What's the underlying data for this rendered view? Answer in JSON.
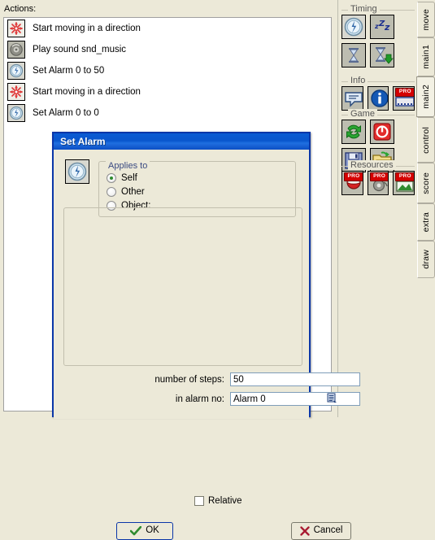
{
  "app": {
    "actions_label": "Actions:"
  },
  "actions_list": {
    "items": [
      {
        "icon": "move-star-icon",
        "label": "Start moving in a direction"
      },
      {
        "icon": "sound-icon",
        "label": "Play sound snd_music"
      },
      {
        "icon": "alarm-clock-icon",
        "label": "Set Alarm 0 to 50"
      },
      {
        "icon": "move-star-icon",
        "label": "Start moving in a direction"
      },
      {
        "icon": "alarm-clock-icon",
        "label": "Set Alarm 0 to 0"
      }
    ]
  },
  "library": {
    "groups": [
      {
        "title": "Timing",
        "buttons": [
          {
            "name": "set-alarm-icon",
            "pro": false
          },
          {
            "name": "sleep-zzz-icon",
            "pro": false
          },
          {
            "name": "set-timeline-icon",
            "pro": false
          },
          {
            "name": "set-timeline-position-icon",
            "pro": false
          }
        ]
      },
      {
        "title": "Info",
        "buttons": [
          {
            "name": "display-message-icon",
            "pro": false
          },
          {
            "name": "show-info-icon",
            "pro": false
          },
          {
            "name": "show-video-icon",
            "pro": true,
            "pro_label": "PRO"
          }
        ]
      },
      {
        "title": "Game",
        "buttons": [
          {
            "name": "restart-game-icon",
            "pro": false
          },
          {
            "name": "end-game-icon",
            "pro": false
          },
          {
            "name": "save-game-icon",
            "pro": false
          },
          {
            "name": "load-game-icon",
            "pro": false
          }
        ]
      },
      {
        "title": "Resources",
        "buttons": [
          {
            "name": "replace-sprite-icon",
            "pro": true,
            "pro_label": "PRO"
          },
          {
            "name": "replace-sound-icon",
            "pro": true,
            "pro_label": "PRO"
          },
          {
            "name": "replace-background-icon",
            "pro": true,
            "pro_label": "PRO"
          }
        ]
      }
    ]
  },
  "tabs": {
    "active": "main2",
    "items": [
      {
        "id": "move",
        "label": "move"
      },
      {
        "id": "main1",
        "label": "main1"
      },
      {
        "id": "main2",
        "label": "main2"
      },
      {
        "id": "control",
        "label": "control"
      },
      {
        "id": "score",
        "label": "score"
      },
      {
        "id": "extra",
        "label": "extra"
      },
      {
        "id": "draw",
        "label": "draw"
      }
    ]
  },
  "dialog": {
    "title": "Set Alarm",
    "action_icon": "alarm-clock-icon",
    "applies_to": {
      "legend": "Applies to",
      "selected": "Self",
      "options": [
        {
          "label": "Self",
          "selected": true
        },
        {
          "label": "Other",
          "selected": false
        },
        {
          "label": "Object:",
          "selected": false
        }
      ]
    },
    "fields": [
      {
        "label": "number of steps:",
        "value": "50",
        "name": "number-of-steps-input"
      },
      {
        "label": "in alarm no:",
        "value": "Alarm 0",
        "name": "alarm-number-input"
      }
    ],
    "menu_icon": "list-menu-icon",
    "relative": {
      "label": "Relative",
      "checked": false
    },
    "buttons": {
      "ok": "OK",
      "cancel": "Cancel"
    }
  },
  "colors": {
    "window_face": "#ece9d8",
    "title_blue": "#0a56cd",
    "dialog_border": "#0a36a8",
    "icon_face": "#bdbdb0",
    "input_border": "#7f9db9",
    "group_label": "#3a4a82",
    "ok_check": "#2f8b2f",
    "cancel_x": "#a81b32",
    "pro_red": "#d40000"
  }
}
